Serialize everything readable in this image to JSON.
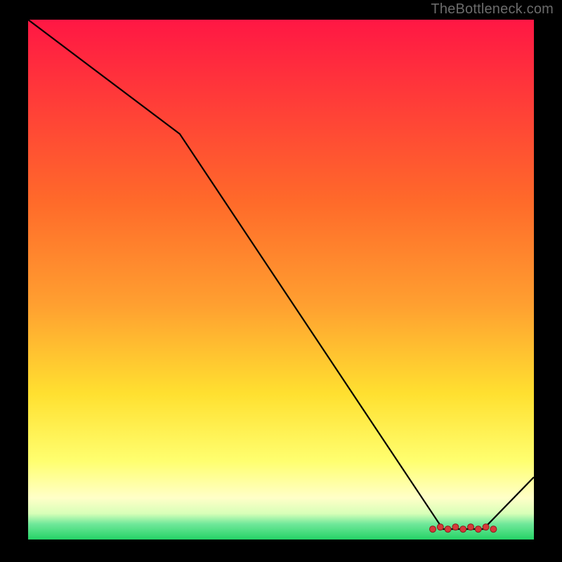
{
  "attribution": "TheBottleneck.com",
  "colors": {
    "top": "#ff1744",
    "mid1": "#ffa030",
    "mid2": "#ffe030",
    "pale": "#ffffc8",
    "green": "#25d366",
    "line": "#000000",
    "marker_fill": "#d53a3a",
    "marker_stroke": "#8a1d1d"
  },
  "chart_data": {
    "type": "line",
    "title": "",
    "xlabel": "",
    "ylabel": "",
    "xlim": [
      0,
      100
    ],
    "ylim": [
      0,
      100
    ],
    "x": [
      0,
      30,
      82,
      90,
      100
    ],
    "values": [
      100,
      78,
      2,
      2,
      12
    ],
    "marker_band": {
      "x_start": 80,
      "x_end": 92,
      "y": 2,
      "count": 9
    }
  }
}
